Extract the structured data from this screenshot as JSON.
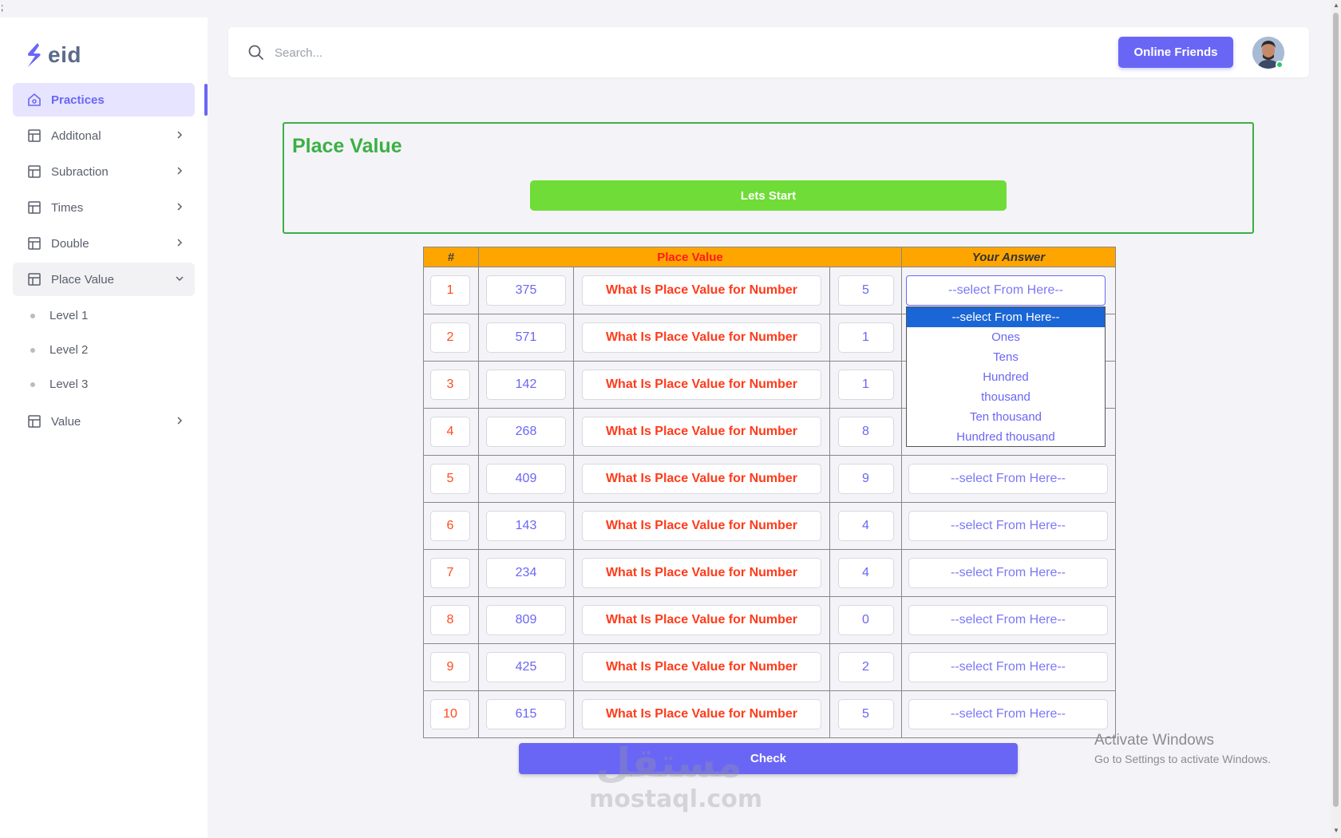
{
  "stray_char": ";",
  "brand": {
    "name": "eid",
    "color": "#6a66f5"
  },
  "sidebar": {
    "items": [
      {
        "label": "Practices",
        "icon": "home-icon",
        "state": "active"
      },
      {
        "label": "Additonal",
        "icon": "layout-icon",
        "chevron": "right"
      },
      {
        "label": "Subraction",
        "icon": "layout-icon",
        "chevron": "right"
      },
      {
        "label": "Times",
        "icon": "layout-icon",
        "chevron": "right"
      },
      {
        "label": "Double",
        "icon": "layout-icon",
        "chevron": "right"
      },
      {
        "label": "Place Value",
        "icon": "layout-icon",
        "chevron": "down",
        "state": "open"
      }
    ],
    "sub_items": [
      "Level 1",
      "Level 2",
      "Level 3"
    ],
    "last_item": {
      "label": "Value",
      "icon": "layout-icon",
      "chevron": "right"
    }
  },
  "topbar": {
    "search_placeholder": "Search...",
    "online_friends_label": "Online Friends"
  },
  "card": {
    "title": "Place Value",
    "start_label": "Lets Start"
  },
  "table": {
    "headers": {
      "index": "#",
      "place_value": "Place Value",
      "answer": "Your Answer"
    },
    "question_text": "What Is Place Value for Number",
    "select_placeholder": "--select From Here--",
    "rows": [
      {
        "n": "1",
        "number": "375",
        "digit": "5"
      },
      {
        "n": "2",
        "number": "571",
        "digit": "1"
      },
      {
        "n": "3",
        "number": "142",
        "digit": "1"
      },
      {
        "n": "4",
        "number": "268",
        "digit": "8"
      },
      {
        "n": "5",
        "number": "409",
        "digit": "9"
      },
      {
        "n": "6",
        "number": "143",
        "digit": "4"
      },
      {
        "n": "7",
        "number": "234",
        "digit": "4"
      },
      {
        "n": "8",
        "number": "809",
        "digit": "0"
      },
      {
        "n": "9",
        "number": "425",
        "digit": "2"
      },
      {
        "n": "10",
        "number": "615",
        "digit": "5"
      }
    ]
  },
  "dropdown": {
    "open_row": 1,
    "current": "--select From Here--",
    "options": [
      "--select From Here--",
      "Ones",
      "Tens",
      "Hundred",
      "thousand",
      "Ten thousand",
      "Hundred thousand"
    ],
    "highlighted": "--select From Here--"
  },
  "check_label": "Check",
  "watermark": {
    "arabic": "مستقل",
    "latin": "mostaql.com"
  },
  "windows_notice": {
    "title": "Activate Windows",
    "subtitle": "Go to Settings to activate Windows."
  },
  "colors": {
    "accent": "#6a66f5",
    "green": "#3cb043",
    "start": "#6fdc37",
    "header": "#ffa500",
    "red": "#ff3b1a"
  }
}
